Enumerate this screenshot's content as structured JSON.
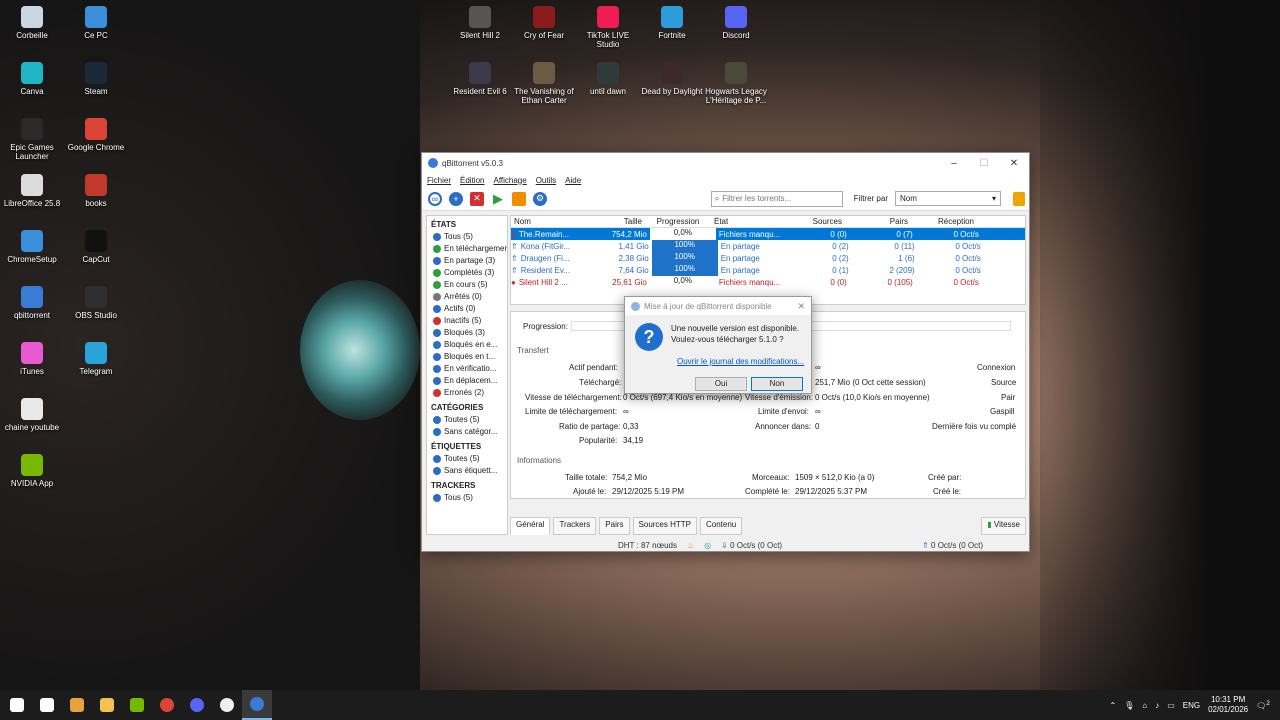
{
  "desktop_icons": [
    {
      "label": "Corbeille",
      "icon": "recycle-bin-icon",
      "color": "#c9d6e3"
    },
    {
      "label": "Ce PC",
      "icon": "computer-icon",
      "color": "#3b8ed8"
    },
    {
      "label": "Canva",
      "icon": "canva-icon",
      "color": "#1fb5c7"
    },
    {
      "label": "Steam",
      "icon": "steam-icon",
      "color": "#1b2838"
    },
    {
      "label": "Epic Games Launcher",
      "icon": "epic-icon",
      "color": "#2a2a2a"
    },
    {
      "label": "Google Chrome",
      "icon": "chrome-icon",
      "color": "#db4437"
    },
    {
      "label": "LibreOffice 25.8",
      "icon": "libreoffice-icon",
      "color": "#dcdcdc"
    },
    {
      "label": "books",
      "icon": "books-icon",
      "color": "#c0392b"
    },
    {
      "label": "ChromeSetup",
      "icon": "setup-icon",
      "color": "#3b8ed8"
    },
    {
      "label": "CapCut",
      "icon": "capcut-icon",
      "color": "#111111"
    },
    {
      "label": "qbittorrent",
      "icon": "qbittorrent-icon",
      "color": "#3a7bd5"
    },
    {
      "label": "OBS Studio",
      "icon": "obs-icon",
      "color": "#302e31"
    },
    {
      "label": "iTunes",
      "icon": "itunes-icon",
      "color": "#e85ad0"
    },
    {
      "label": "Telegram",
      "icon": "telegram-icon",
      "color": "#2aa3d9"
    },
    {
      "label": "chaine youtube",
      "icon": "document-icon",
      "color": "#e9e9e9"
    },
    {
      "label": "NVIDIA App",
      "icon": "nvidia-icon",
      "color": "#76b900"
    },
    {
      "label": "Silent Hill 2",
      "icon": "game-icon",
      "color": "#555555"
    },
    {
      "label": "Cry of Fear",
      "icon": "game-icon",
      "color": "#8a1c1c"
    },
    {
      "label": "TikTok LIVE Studio",
      "icon": "tiktok-icon",
      "color": "#ee1d52"
    },
    {
      "label": "Fortnite",
      "icon": "fortnite-icon",
      "color": "#2d9cdb"
    },
    {
      "label": "Discord",
      "icon": "discord-icon",
      "color": "#5865f2"
    },
    {
      "label": "Resident Evil 6",
      "icon": "game-icon",
      "color": "#3a3a4a"
    },
    {
      "label": "The Vanishing of Ethan Carter",
      "icon": "game-icon",
      "color": "#6b5a44"
    },
    {
      "label": "until dawn",
      "icon": "game-icon",
      "color": "#2f3b3b"
    },
    {
      "label": "Dead by Daylight",
      "icon": "game-icon",
      "color": "#3c2a2a"
    },
    {
      "label": "Hogwarts Legacy L'Héritage de P...",
      "icon": "game-icon",
      "color": "#4a4a3a"
    }
  ],
  "window": {
    "title": "qBittorrent v5.0.3",
    "menu": [
      "Fichier",
      "Édition",
      "Affichage",
      "Outils",
      "Aide"
    ],
    "search_placeholder": "Filtrer les torrents...",
    "filter_label": "Filtrer par",
    "filter_value": "Nom"
  },
  "sidebar": {
    "states_header": "ÉTATS",
    "states": [
      {
        "label": "Tous (5)",
        "color": "#2b6cc4"
      },
      {
        "label": "En téléchargement",
        "color": "#2e9e3e"
      },
      {
        "label": "En partage (3)",
        "color": "#2b6cc4"
      },
      {
        "label": "Complétés (3)",
        "color": "#2e9e3e"
      },
      {
        "label": "En cours (5)",
        "color": "#2e9e3e"
      },
      {
        "label": "Arrêtés (0)",
        "color": "#777777"
      },
      {
        "label": "Actifs (0)",
        "color": "#2b6cc4"
      },
      {
        "label": "Inactifs (5)",
        "color": "#d03030"
      },
      {
        "label": "Bloqués (3)",
        "color": "#2b6cc4"
      },
      {
        "label": "Bloqués en e...",
        "color": "#2b6cc4"
      },
      {
        "label": "Bloqués en t...",
        "color": "#2b6cc4"
      },
      {
        "label": "En vérificatio...",
        "color": "#2b6cc4"
      },
      {
        "label": "En déplacem...",
        "color": "#2b6cc4"
      },
      {
        "label": "Erronés (2)",
        "color": "#d03030"
      }
    ],
    "categories_header": "CATÉGORIES",
    "categories": [
      "Toutes (5)",
      "Sans catégor..."
    ],
    "labels_header": "ÉTIQUETTES",
    "labels": [
      "Toutes (5)",
      "Sans étiquett..."
    ],
    "trackers_header": "TRACKERS",
    "trackers": [
      "Tous (5)"
    ]
  },
  "torrent_table": {
    "headers": [
      "Nom",
      "Taille",
      "Progression",
      "État",
      "Sources",
      "Pairs",
      "Réception"
    ],
    "rows": [
      {
        "name": "The.Remain...",
        "size": "754,2 Mio",
        "progress": 0.0,
        "progress_text": "0,0%",
        "state": "Fichiers manqu...",
        "sources": "0 (0)",
        "peers": "0 (7)",
        "down": "0 Oct/s",
        "selected": true,
        "error": true
      },
      {
        "name": "Kona (FitGir...",
        "size": "1,41 Gio",
        "progress": 1.0,
        "progress_text": "100%",
        "state": "En partage",
        "sources": "0 (2)",
        "peers": "0 (11)",
        "down": "0 Oct/s",
        "selected": false,
        "error": false
      },
      {
        "name": "Draugen (Fi...",
        "size": "2,38 Gio",
        "progress": 1.0,
        "progress_text": "100%",
        "state": "En partage",
        "sources": "0 (2)",
        "peers": "1 (6)",
        "down": "0 Oct/s",
        "selected": false,
        "error": false
      },
      {
        "name": "Resident Ev...",
        "size": "7,64 Gio",
        "progress": 1.0,
        "progress_text": "100%",
        "state": "En partage",
        "sources": "0 (1)",
        "peers": "2 (209)",
        "down": "0 Oct/s",
        "selected": false,
        "error": false
      },
      {
        "name": "Silent Hill 2 ...",
        "size": "25,61 Gio",
        "progress": 0.0,
        "progress_text": "0,0%",
        "state": "Fichiers manqu...",
        "sources": "0 (0)",
        "peers": "0 (105)",
        "down": "0 Oct/s",
        "selected": false,
        "error": true
      }
    ]
  },
  "details": {
    "progression_label": "Progression:",
    "transfer_header": "Transfert",
    "active_label": "Actif pendant:",
    "active_value": "∞",
    "downloaded_label": "Téléchargé:",
    "uploaded_value": "251,7 Mio (0 Oct cette session)",
    "connexions_label": "Connexion",
    "sources_label": "Source",
    "dl_speed_label": "Vitesse de téléchargement:",
    "dl_speed_value": "0 Oct/s (697,4 Kio/s en moyenne)",
    "ul_speed_label": "Vitesse d'émission:",
    "ul_speed_value": "0 Oct/s (10,0 Kio/s en moyenne)",
    "pairs_label": "Pair",
    "dl_limit_label": "Limite de téléchargement:",
    "dl_limit_value": "∞",
    "ul_limit_label": "Limite d'envoi:",
    "ul_limit_value": "∞",
    "waste_label": "Gaspill",
    "ratio_label": "Ratio de partage:",
    "ratio_value": "0,33",
    "announce_label": "Annoncer dans:",
    "announce_value": "0",
    "last_seen_label": "Dernière fois vu complé",
    "popularity_label": "Popularité:",
    "popularity_value": "34,19",
    "info_header": "Informations",
    "total_size_label": "Taille totale:",
    "total_size_value": "754,2 Mio",
    "pieces_label": "Morceaux:",
    "pieces_value": "1509 × 512,0 Kio (a 0)",
    "created_by_label": "Créé par:",
    "added_label": "Ajouté le:",
    "added_value": "29/12/2025 5:19 PM",
    "completed_label": "Complété le:",
    "completed_value": "29/12/2025 5:37 PM",
    "created_on_label": "Créé le:"
  },
  "bottom_tabs": [
    "Général",
    "Trackers",
    "Pairs",
    "Sources HTTP",
    "Contenu"
  ],
  "speed_tab": "Vitesse",
  "statusbar": {
    "dht": "DHT : 87 nœuds",
    "down": "0 Oct/s (0 Oct)",
    "up": "0 Oct/s (0 Oct)"
  },
  "dialog": {
    "title": "Mise à jour de qBittorrent disponible",
    "line1": "Une nouvelle version est disponible.",
    "line2": "Voulez-vous télécharger 5.1.0 ?",
    "link": "Ouvrir le journal des modifications...",
    "yes": "Oui",
    "no": "Non"
  },
  "taskbar": {
    "apps": [
      {
        "name": "start",
        "color": "#ffffff"
      },
      {
        "name": "store",
        "color": "#ffffff"
      },
      {
        "name": "copilot",
        "color": "#e9a13b"
      },
      {
        "name": "explorer",
        "color": "#f2c14e"
      },
      {
        "name": "nvidia",
        "color": "#76b900"
      },
      {
        "name": "chrome",
        "color": "#db4437"
      },
      {
        "name": "discord",
        "color": "#5865f2"
      },
      {
        "name": "obs",
        "color": "#eeeeee"
      },
      {
        "name": "qbittorrent",
        "color": "#3a7bd5"
      }
    ],
    "lang": "ENG",
    "time": "10:31 PM",
    "date": "02/01/2026",
    "notif": "2"
  }
}
